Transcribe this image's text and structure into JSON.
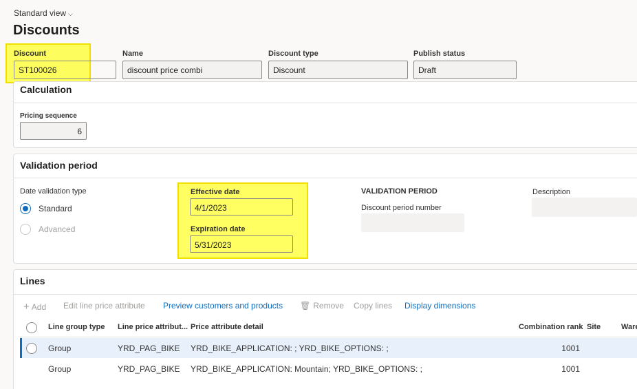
{
  "header": {
    "view_label": "Standard view",
    "view_icon": "chevron-down-icon",
    "title": "Discounts"
  },
  "fields": {
    "discount": {
      "label": "Discount",
      "value": "ST100026"
    },
    "name": {
      "label": "Name",
      "value": "discount price combi"
    },
    "discount_type": {
      "label": "Discount type",
      "value": "Discount"
    },
    "publish_status": {
      "label": "Publish status",
      "value": "Draft"
    }
  },
  "calculation": {
    "title": "Calculation",
    "pricing_sequence_label": "Pricing sequence",
    "pricing_sequence_value": "6"
  },
  "validation": {
    "title": "Validation period",
    "date_validation_type_label": "Date validation type",
    "options": [
      {
        "label": "Standard",
        "selected": true,
        "disabled": false
      },
      {
        "label": "Advanced",
        "selected": false,
        "disabled": true
      }
    ],
    "effective_date_label": "Effective date",
    "effective_date_value": "4/1/2023",
    "expiration_date_label": "Expiration date",
    "expiration_date_value": "5/31/2023",
    "section_heading": "VALIDATION PERIOD",
    "discount_period_number_label": "Discount period number",
    "discount_period_number_value": "",
    "description_label": "Description",
    "description_value": ""
  },
  "lines": {
    "title": "Lines",
    "toolbar": {
      "add": "Add",
      "edit_price_attribute": "Edit line price attribute",
      "preview": "Preview customers and products",
      "remove": "Remove",
      "copy_lines": "Copy lines",
      "display_dimensions": "Display dimensions"
    },
    "columns": [
      "Line group type",
      "Line price attribut...",
      "Price attribute detail",
      "Combination rank",
      "Site",
      "Wareh"
    ],
    "rows": [
      {
        "group_type": "Group",
        "price_attribute": "YRD_PAG_BIKE",
        "detail": "YRD_BIKE_APPLICATION: ; YRD_BIKE_OPTIONS: ;",
        "rank": "1001",
        "selected": true
      },
      {
        "group_type": "Group",
        "price_attribute": "YRD_PAG_BIKE",
        "detail": "YRD_BIKE_APPLICATION: Mountain; YRD_BIKE_OPTIONS: ;",
        "rank": "1001",
        "selected": false
      }
    ]
  },
  "colors": {
    "accent": "#0f6cbd",
    "highlight": "#ffff00"
  }
}
